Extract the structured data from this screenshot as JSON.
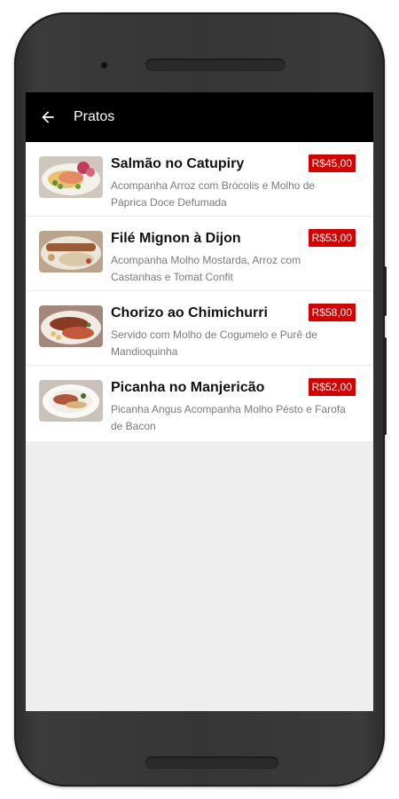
{
  "appbar": {
    "title": "Pratos",
    "back_icon": "arrow-left-icon"
  },
  "accent_color": "#d40000",
  "items": [
    {
      "name": "Salmão no Catupiry",
      "price": "R$45,00",
      "description": "Acompanha Arroz com Brócolis e Molho de Páprica Doce Defumada",
      "image": "salmon-dish-photo"
    },
    {
      "name": "Filé Mignon à Dijon",
      "price": "R$53,00",
      "description": "Acompanha Molho Mostarda, Arroz com Castanhas e Tomat Confit",
      "image": "filet-mignon-dish-photo"
    },
    {
      "name": "Chorizo ao Chimichurri",
      "price": "R$58,00",
      "description": "Servido com Molho de Cogumelo e Purê de Mandioquinha",
      "image": "chorizo-dish-photo"
    },
    {
      "name": "Picanha no Manjericão",
      "price": "R$52,00",
      "description": "Picanha Angus Acompanha Molho Pésto e Farofa de Bacon",
      "image": "picanha-dish-photo"
    }
  ]
}
